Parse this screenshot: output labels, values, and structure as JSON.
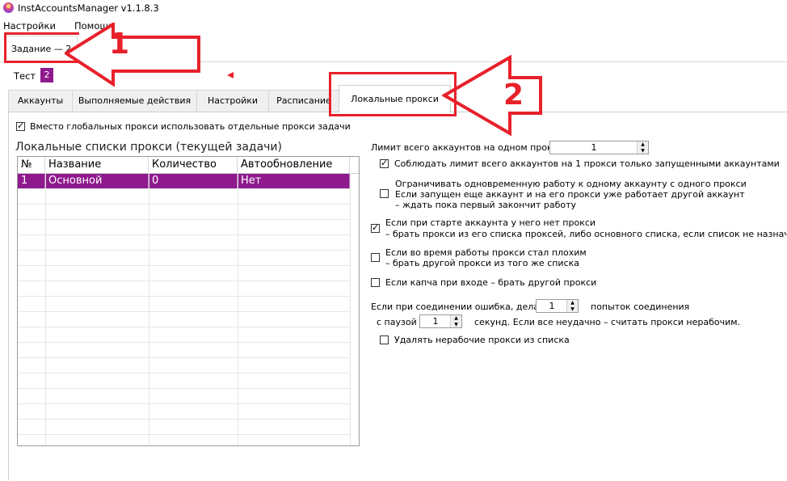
{
  "window": {
    "title": "InstAccountsManager v1.1.8.3"
  },
  "menu": {
    "items": [
      "Настройки",
      "Помощь"
    ]
  },
  "task_tab": {
    "label": "Задание — 2"
  },
  "subtask": {
    "label": "Тест",
    "badge": "2"
  },
  "tabs": [
    {
      "label": "Аккаунты"
    },
    {
      "label": "Выполняемые действия"
    },
    {
      "label": "Настройки"
    },
    {
      "label": "Расписание"
    },
    {
      "label": "Локальные прокси"
    }
  ],
  "use_local_proxy": {
    "label": "Вместо глобальных прокси использовать отдельные прокси задачи",
    "checked": true
  },
  "proxy_lists": {
    "title": "Локальные списки прокси (текущей задачи)",
    "columns": [
      "№",
      "Название",
      "Количество",
      "Автообновление"
    ],
    "rows": [
      {
        "num": "1",
        "name": "Основной",
        "count": "0",
        "auto": "Нет"
      }
    ]
  },
  "limit": {
    "label": "Лимит всего аккаунтов на одном прокси",
    "value": "1"
  },
  "options": {
    "respect_limit": {
      "label": "Соблюдать лимит всего аккаунтов на 1 прокси только запущенными аккаунтами",
      "checked": true
    },
    "single_account": {
      "lines": [
        "Ограничивать одновременную работу к одному аккаунту с одного прокси",
        "Если запущен еще аккаунт и на его прокси уже работает другой аккаунт",
        "– ждать пока первый закончит работу"
      ],
      "checked": false
    },
    "no_proxy_on_start": {
      "lines": [
        "Если при старте аккаунта у него нет прокси",
        "– брать прокси из его списка проксей, либо основного списка, если список не назначен"
      ],
      "checked": true
    },
    "bad_proxy": {
      "lines": [
        "Если во время работы прокси стал плохим",
        "– брать другой прокси из того же списка"
      ],
      "checked": false
    },
    "captcha": {
      "label": "Если капча при входе – брать другой прокси",
      "checked": false
    }
  },
  "connection_error": {
    "prefix": "Если при соединении ошибка, делать",
    "attempts": "1",
    "attempts_suffix": "попыток соединения",
    "pause_prefix": "с паузой",
    "pause": "1",
    "pause_suffix": "секунд. Если все неудачно – считать прокси нерабочим."
  },
  "delete_bad": {
    "label": "Удалять нерабочие прокси из списка",
    "checked": false
  },
  "annotations": {
    "callout1": "1",
    "callout2": "2"
  },
  "colors": {
    "accent": "#8e1a8e",
    "callout": "#e8202a"
  }
}
